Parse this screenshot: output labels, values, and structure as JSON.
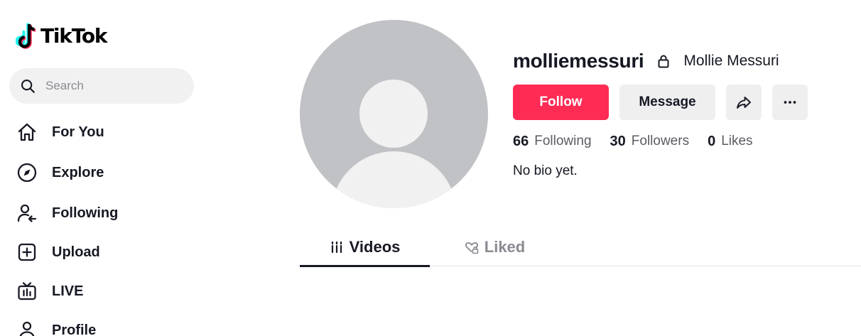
{
  "app": {
    "logo_text": "TikTok",
    "accent_color": "#fe2c55"
  },
  "search": {
    "placeholder": "Search",
    "value": "",
    "icon": "search-icon"
  },
  "sidebar": {
    "items": [
      {
        "label": "For You",
        "icon": "home-icon"
      },
      {
        "label": "Explore",
        "icon": "compass-icon"
      },
      {
        "label": "Following",
        "icon": "following-users-icon"
      },
      {
        "label": "Upload",
        "icon": "plus-square-icon"
      },
      {
        "label": "LIVE",
        "icon": "live-tv-icon"
      },
      {
        "label": "Profile",
        "icon": "person-icon"
      }
    ]
  },
  "profile": {
    "username": "molliemessuri",
    "display_name": "Mollie Messuri",
    "private_icon": "lock-icon",
    "bio": "No bio yet.",
    "follow_label": "Follow",
    "message_label": "Message",
    "share_icon": "share-arrow-icon",
    "more_icon": "more-dots-icon",
    "stats": [
      {
        "count": "66",
        "label": "Following"
      },
      {
        "count": "30",
        "label": "Followers"
      },
      {
        "count": "0",
        "label": "Likes"
      }
    ]
  },
  "tabs": [
    {
      "label": "Videos",
      "icon": "grid-bars-icon",
      "active": true
    },
    {
      "label": "Liked",
      "icon": "heart-lock-icon",
      "active": false
    }
  ]
}
